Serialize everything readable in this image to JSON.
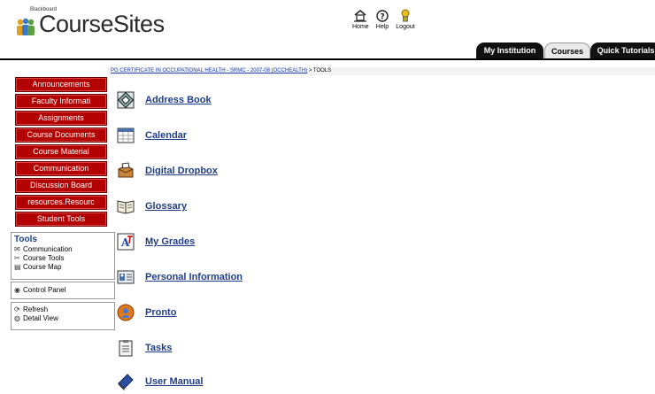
{
  "header": {
    "brand_small": "Blackboard",
    "brand": "CourseSites",
    "utility": {
      "home": "Home",
      "help": "Help",
      "logout": "Logout"
    }
  },
  "tabs": [
    {
      "label": "My Institution",
      "active": false
    },
    {
      "label": "Courses",
      "active": true
    },
    {
      "label": "Quick Tutorials",
      "active": false
    }
  ],
  "course_menu": [
    "Announcements",
    "Faculty Informati",
    "Assignments",
    "Course Documents",
    "Course Material",
    "Communication",
    "Discussion Board",
    "resources.Resourc",
    "Student Tools"
  ],
  "tools_panel": {
    "title": "Tools",
    "items": [
      "Communication",
      "Course Tools",
      "Course Map"
    ]
  },
  "control_panel": "Control Panel",
  "refresh_panel": {
    "items": [
      "Refresh",
      "Detail View"
    ]
  },
  "breadcrumb": {
    "link": "PG CERTIFICATE IN OCCUPATIONAL HEALTH - SRMC - 2007-08 (OCCHEALTH)",
    "separator": " > ",
    "current": "TOOLS"
  },
  "tools": [
    {
      "label": "Address Book",
      "icon": "address-book-icon"
    },
    {
      "label": "Calendar",
      "icon": "calendar-icon"
    },
    {
      "label": "Digital Dropbox",
      "icon": "dropbox-icon"
    },
    {
      "label": "Glossary",
      "icon": "glossary-icon"
    },
    {
      "label": "My Grades",
      "icon": "grades-icon"
    },
    {
      "label": "Personal Information",
      "icon": "personal-info-icon"
    },
    {
      "label": "Pronto",
      "icon": "pronto-icon"
    },
    {
      "label": "Tasks",
      "icon": "tasks-icon"
    },
    {
      "label": "User Manual",
      "icon": "user-manual-icon"
    }
  ],
  "colors": {
    "menu_button": "#b30000",
    "link": "#1f3d8a",
    "tab_dark": "#111111"
  }
}
